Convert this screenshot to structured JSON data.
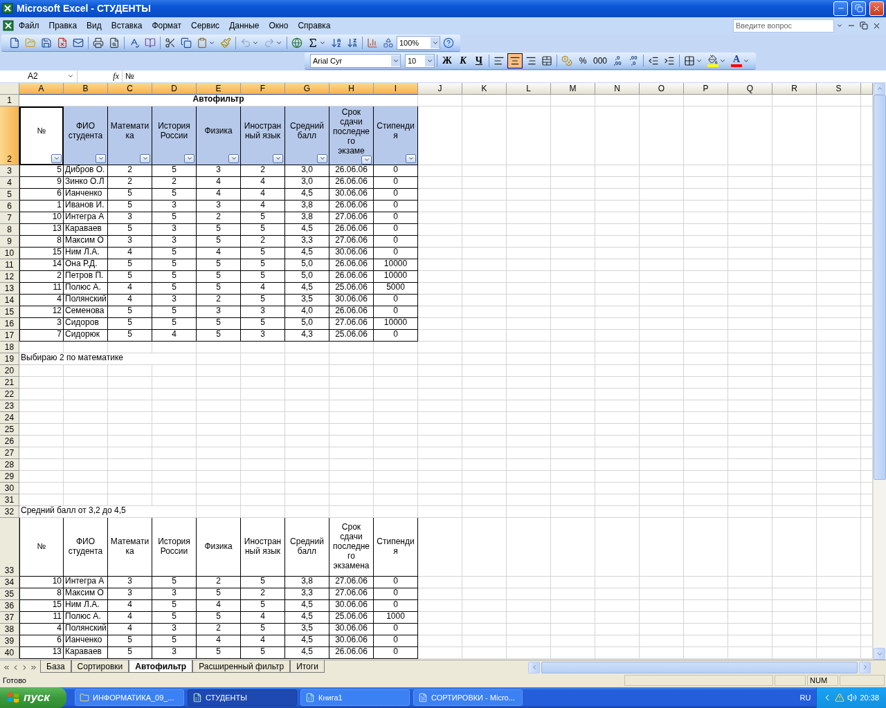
{
  "window": {
    "title": "Microsoft Excel - СТУДЕНТЫ"
  },
  "menu": [
    "Файл",
    "Правка",
    "Вид",
    "Вставка",
    "Формат",
    "Сервис",
    "Данные",
    "Окно",
    "Справка"
  ],
  "help_box": {
    "placeholder": "Введите вопрос"
  },
  "standard_toolbar": {
    "zoom": "100%"
  },
  "formatting_toolbar": {
    "font": "Arial Cyr",
    "size": "10",
    "bold": "Ж",
    "italic": "К",
    "underline": "Ч",
    "align": [
      {
        "kind": "left",
        "selected": false
      },
      {
        "kind": "center",
        "selected": true
      },
      {
        "kind": "right",
        "selected": false
      }
    ],
    "percent": "%",
    "thousands": "000",
    "increase_decimal": [
      ",0",
      ",00"
    ],
    "decrease_decimal": [
      ",00",
      ",0"
    ],
    "font_color": "A"
  },
  "formula_bar": {
    "name_box": "A2",
    "function_label": "fx",
    "formula": "№"
  },
  "columns": [
    {
      "label": "A",
      "selected": true
    },
    {
      "label": "B",
      "selected": true
    },
    {
      "label": "C",
      "selected": true
    },
    {
      "label": "D",
      "selected": true
    },
    {
      "label": "E",
      "selected": true
    },
    {
      "label": "F",
      "selected": true
    },
    {
      "label": "G",
      "selected": true
    },
    {
      "label": "H",
      "selected": true
    },
    {
      "label": "I",
      "selected": true
    },
    {
      "label": "J",
      "selected": false
    },
    {
      "label": "K",
      "selected": false
    },
    {
      "label": "L",
      "selected": false
    },
    {
      "label": "M",
      "selected": false
    },
    {
      "label": "N",
      "selected": false
    },
    {
      "label": "O",
      "selected": false
    },
    {
      "label": "P",
      "selected": false
    },
    {
      "label": "Q",
      "selected": false
    },
    {
      "label": "R",
      "selected": false
    },
    {
      "label": "S",
      "selected": false
    }
  ],
  "rows": [
    {
      "label": "1",
      "selected": false
    },
    {
      "label": "2",
      "selected": true
    },
    {
      "label": "3",
      "selected": false
    },
    {
      "label": "4",
      "selected": false
    },
    {
      "label": "5",
      "selected": false
    },
    {
      "label": "6",
      "selected": false
    },
    {
      "label": "7",
      "selected": false
    },
    {
      "label": "8",
      "selected": false
    },
    {
      "label": "9",
      "selected": false
    },
    {
      "label": "10",
      "selected": false
    },
    {
      "label": "11",
      "selected": false
    },
    {
      "label": "12",
      "selected": false
    },
    {
      "label": "13",
      "selected": false
    },
    {
      "label": "14",
      "selected": false
    },
    {
      "label": "15",
      "selected": false
    },
    {
      "label": "16",
      "selected": false
    },
    {
      "label": "17",
      "selected": false
    },
    {
      "label": "18",
      "selected": false
    },
    {
      "label": "19",
      "selected": false
    },
    {
      "label": "20",
      "selected": false
    },
    {
      "label": "21",
      "selected": false
    },
    {
      "label": "22",
      "selected": false
    },
    {
      "label": "23",
      "selected": false
    },
    {
      "label": "24",
      "selected": false
    },
    {
      "label": "25",
      "selected": false
    },
    {
      "label": "26",
      "selected": false
    },
    {
      "label": "27",
      "selected": false
    },
    {
      "label": "28",
      "selected": false
    },
    {
      "label": "29",
      "selected": false
    },
    {
      "label": "30",
      "selected": false
    },
    {
      "label": "31",
      "selected": false
    },
    {
      "label": "32",
      "selected": false
    },
    {
      "label": "33",
      "selected": false
    },
    {
      "label": "34",
      "selected": false
    },
    {
      "label": "35",
      "selected": false
    },
    {
      "label": "36",
      "selected": false
    },
    {
      "label": "37",
      "selected": false
    },
    {
      "label": "38",
      "selected": false
    },
    {
      "label": "39",
      "selected": false
    },
    {
      "label": "40",
      "selected": false
    }
  ],
  "autofilter_table": {
    "title": "Автофильтр",
    "autofilter": true,
    "header": [
      "№",
      "ФИО\nстудента",
      "Математи\nка",
      "История\nРоссии",
      "Физика",
      "Иностран\nный язык",
      "Средний\nбалл",
      "Срок\nсдачи\nпоследне\nго\nэкзаме",
      "Стипенди\nя"
    ],
    "rows": [
      [
        "5",
        "Дибров О.",
        "2",
        "5",
        "3",
        "2",
        "3,0",
        "26.06.06",
        "0"
      ],
      [
        "9",
        "Зинко О.Л",
        "2",
        "2",
        "4",
        "4",
        "3,0",
        "26.06.06",
        "0"
      ],
      [
        "6",
        "Ианченко",
        "5",
        "5",
        "4",
        "4",
        "4,5",
        "30.06.06",
        "0"
      ],
      [
        "1",
        "Иванов И.",
        "5",
        "3",
        "3",
        "4",
        "3,8",
        "26.06.06",
        "0"
      ],
      [
        "10",
        "Интегра А",
        "3",
        "5",
        "2",
        "5",
        "3,8",
        "27.06.06",
        "0"
      ],
      [
        "13",
        "Караваев",
        "5",
        "3",
        "5",
        "5",
        "4,5",
        "26.06.06",
        "0"
      ],
      [
        "8",
        "Максим О",
        "3",
        "3",
        "5",
        "2",
        "3,3",
        "27.06.06",
        "0"
      ],
      [
        "15",
        "Ним Л.А.",
        "4",
        "5",
        "4",
        "5",
        "4,5",
        "30.06.06",
        "0"
      ],
      [
        "14",
        "Она Р.Д.",
        "5",
        "5",
        "5",
        "5",
        "5,0",
        "26.06.06",
        "10000"
      ],
      [
        "2",
        "Петров П.",
        "5",
        "5",
        "5",
        "5",
        "5,0",
        "26.06.06",
        "10000"
      ],
      [
        "11",
        "Полюс А.",
        "4",
        "5",
        "5",
        "4",
        "4,5",
        "25.06.06",
        "5000"
      ],
      [
        "4",
        "Полянский",
        "4",
        "3",
        "2",
        "5",
        "3,5",
        "30.06.06",
        "0"
      ],
      [
        "12",
        "Семенова",
        "5",
        "5",
        "3",
        "3",
        "4,0",
        "26.06.06",
        "0"
      ],
      [
        "3",
        "Сидоров",
        "5",
        "5",
        "5",
        "5",
        "5,0",
        "27.06.06",
        "10000"
      ],
      [
        "7",
        "Сидорюк",
        "5",
        "4",
        "5",
        "3",
        "4,3",
        "25.06.06",
        "0"
      ]
    ]
  },
  "notes": [
    "Выбираю 2 по математике",
    "Средний балл от 3,2 до 4,5"
  ],
  "filtered_table": {
    "header": [
      "№",
      "ФИО\nстудента",
      "Математи\nка",
      "История\nРоссии",
      "Физика",
      "Иностран\nный язык",
      "Средний\nбалл",
      "Срок\nсдачи\nпоследне\nго\nэкзамена",
      "Стипенди\nя"
    ],
    "rows": [
      [
        "10",
        "Интегра А",
        "3",
        "5",
        "2",
        "5",
        "3,8",
        "27.06.06",
        "0"
      ],
      [
        "8",
        "Максим О",
        "3",
        "3",
        "5",
        "2",
        "3,3",
        "27.06.06",
        "0"
      ],
      [
        "15",
        "Ним Л.А.",
        "4",
        "5",
        "4",
        "5",
        "4,5",
        "30.06.06",
        "0"
      ],
      [
        "11",
        "Полюс А.",
        "4",
        "5",
        "5",
        "4",
        "4,5",
        "25.06.06",
        "1000"
      ],
      [
        "4",
        "Полянский",
        "4",
        "3",
        "2",
        "5",
        "3,5",
        "30.06.06",
        "0"
      ],
      [
        "6",
        "Ианченко",
        "5",
        "5",
        "4",
        "4",
        "4,5",
        "30.06.06",
        "0"
      ],
      [
        "13",
        "Караваев",
        "5",
        "3",
        "5",
        "5",
        "4,5",
        "26.06.06",
        "0"
      ]
    ]
  },
  "sheet_tabs": [
    {
      "label": "База",
      "selected": false
    },
    {
      "label": "Сортировки",
      "selected": false
    },
    {
      "label": "Автофильтр",
      "selected": true
    },
    {
      "label": "Расширенный фильтр",
      "selected": false
    },
    {
      "label": "Итоги",
      "selected": false
    }
  ],
  "status_bar": {
    "text": "Готово",
    "indicator": "NUM"
  },
  "taskbar": {
    "start": "пуск",
    "tasks": [
      {
        "label": "ИНФОРМАТИКА_09_...",
        "kind": "folder",
        "selected": false
      },
      {
        "label": "СТУДЕНТЫ",
        "kind": "excel",
        "selected": true
      },
      {
        "label": "Книга1",
        "kind": "excel",
        "selected": false
      },
      {
        "label": "СОРТИРОВКИ - Micro...",
        "kind": "word",
        "selected": false
      }
    ],
    "language": "RU",
    "clock": "20:38"
  }
}
